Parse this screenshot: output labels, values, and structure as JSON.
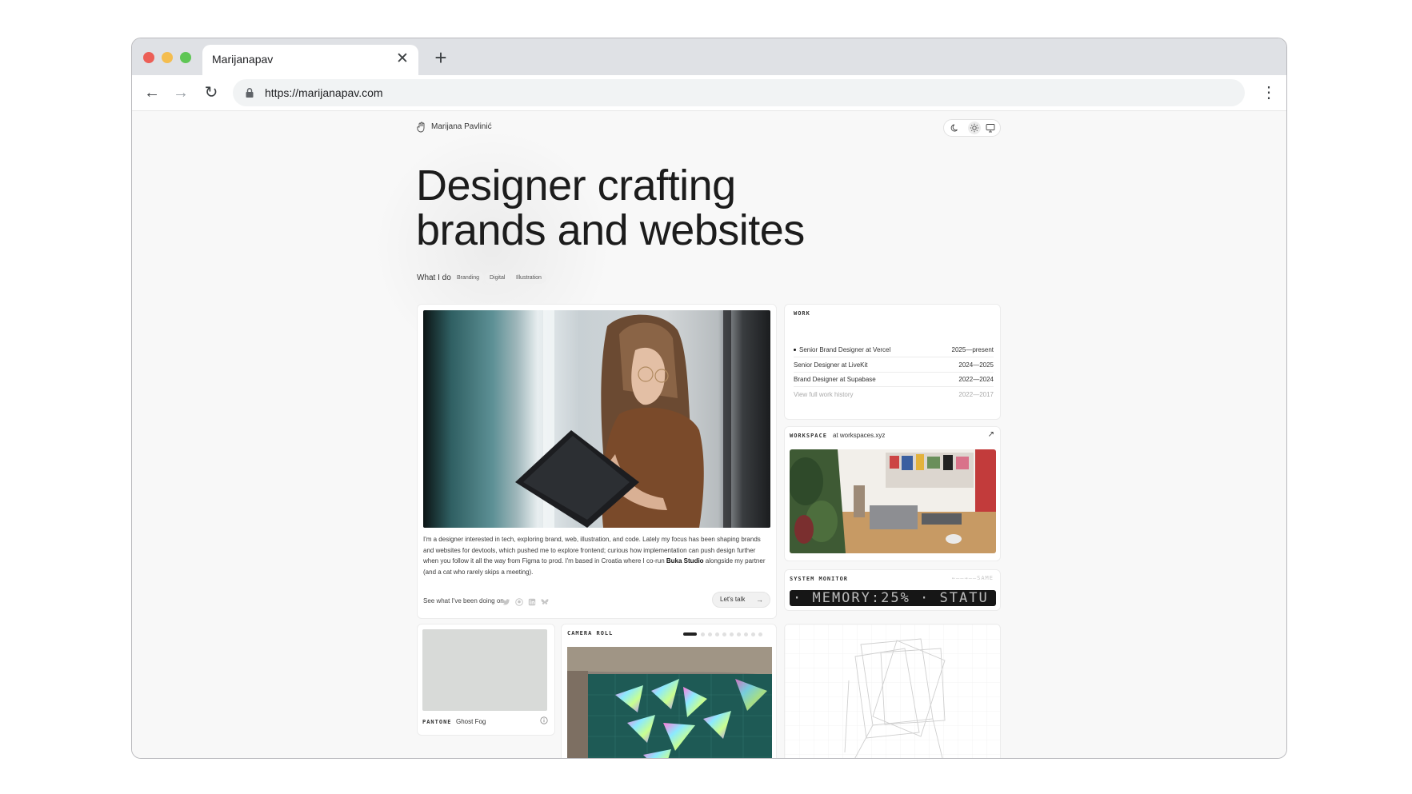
{
  "browser": {
    "tab_title": "Marijanapav",
    "url": "https://marijanapav.com",
    "tab_close_glyph": "✕",
    "new_tab_glyph": "+",
    "back_glyph": "←",
    "forward_glyph": "→",
    "reload_glyph": "↻",
    "menu_glyph": "⋮"
  },
  "site": {
    "name": "Marijana Pavlinić",
    "hero_title_line1": "Designer crafting",
    "hero_title_line2": "brands and websites",
    "what_label": "What I do",
    "tags": [
      "Branding",
      "Digital",
      "Illustration"
    ],
    "theme_icons": [
      "moon-icon",
      "sun-icon",
      "monitor-icon"
    ]
  },
  "bio": {
    "text_before": "I'm a designer interested in tech, exploring brand, web, illustration, and code. Lately my focus has been shaping brands and websites for devtools, which pushed me to explore frontend; curious how implementation can push design further when you follow it all the way from Figma to prod. I'm based in Croatia where I co-run ",
    "studio": "Buka Studio",
    "text_after": " alongside my partner (and a cat who rarely skips a meeting).",
    "see_label": "See what I've been doing on",
    "social_icons": [
      "twitter-icon",
      "github-icon",
      "linkedin-icon",
      "bluesky-icon"
    ],
    "cta_label": "Let's talk",
    "cta_arrow": "→"
  },
  "work": {
    "label": "WORK",
    "items": [
      {
        "role": "Senior Brand Designer at Vercel",
        "years": "2025—present",
        "current": true
      },
      {
        "role": "Senior Designer at LiveKit",
        "years": "2024—2025"
      },
      {
        "role": "Brand Designer at Supabase",
        "years": "2022—2024"
      },
      {
        "role": "View full work history",
        "years": "2022—2017"
      }
    ]
  },
  "workspace": {
    "label": "WORKSPACE",
    "at": "at workspaces.xyz",
    "arrow": "↗"
  },
  "system_monitor": {
    "label": "SYSTEM MONITOR",
    "extra": "←——→——SAME",
    "ticker": "· MEMORY:25% · STATU"
  },
  "pantone": {
    "label": "PANTONE",
    "name": "Ghost Fog",
    "swatch_color": "#d8dad8"
  },
  "camera_roll": {
    "label": "CAMERA ROLL",
    "pages": 10,
    "active_page": 1
  }
}
